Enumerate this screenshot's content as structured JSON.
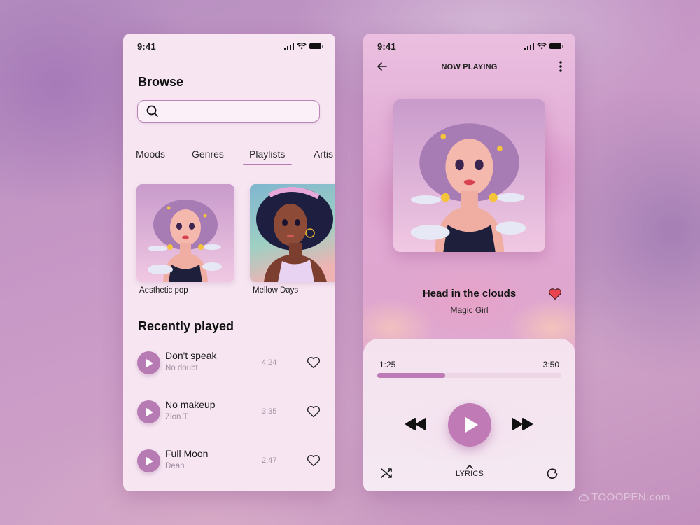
{
  "browse_screen": {
    "status_bar": {
      "time": "9:41"
    },
    "title": "Browse",
    "search": {
      "placeholder": "",
      "value": ""
    },
    "tabs": [
      {
        "label": "Moods",
        "active": false
      },
      {
        "label": "Genres",
        "active": false
      },
      {
        "label": "Playlists",
        "active": true
      },
      {
        "label": "Artis",
        "active": false
      }
    ],
    "playlists": [
      {
        "name": "Aesthetic pop",
        "art": "girl-purple-hair-clouds"
      },
      {
        "name": "Mellow Days",
        "art": "girl-curly-hair-headband"
      }
    ],
    "recently_played": {
      "title": "Recently played",
      "tracks": [
        {
          "title": "Don't speak",
          "artist": "No doubt",
          "duration": "4:24",
          "liked": false
        },
        {
          "title": "No makeup",
          "artist": "Zion.T",
          "duration": "3:35",
          "liked": false
        },
        {
          "title": "Full Moon",
          "artist": "Dean",
          "duration": "2:47",
          "liked": false
        }
      ]
    }
  },
  "now_playing_screen": {
    "status_bar": {
      "time": "9:41"
    },
    "header": {
      "title": "NOW PLAYING",
      "back_icon": "arrow-left-icon",
      "menu_icon": "more-vertical-icon"
    },
    "song": {
      "title": "Head in the clouds",
      "artist": "Magic Girl",
      "liked": true,
      "art": "girl-purple-hair-clouds"
    },
    "progress": {
      "current": "1:25",
      "total": "3:50",
      "fraction": 0.37
    },
    "controls": {
      "rewind_icon": "rewind-icon",
      "play_icon": "play-icon",
      "fast_forward_icon": "fast-forward-icon",
      "shuffle_icon": "shuffle-icon",
      "repeat_icon": "repeat-icon",
      "lyrics_label": "LYRICS"
    }
  },
  "colors": {
    "accent": "#bc7bb7",
    "heart_liked": "#e8434f",
    "panel_bg": "#f7e6f2"
  },
  "watermark": "TOOOPEN.com"
}
